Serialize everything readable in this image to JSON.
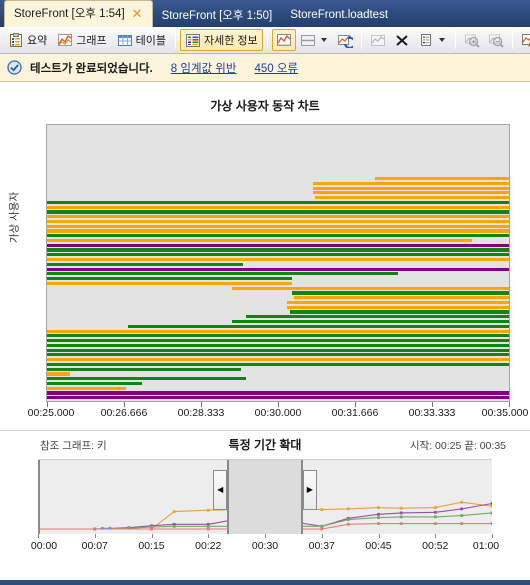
{
  "window": {
    "tabs": [
      {
        "label": "StoreFront [오후 1:54]",
        "active": true,
        "closable": true,
        "close_glyph": "✕"
      },
      {
        "label": "StoreFront [오후 1:50]",
        "active": false,
        "closable": false
      },
      {
        "label": "StoreFront.loadtest",
        "active": false,
        "closable": false
      }
    ]
  },
  "toolbar": {
    "items": [
      {
        "name": "summary",
        "label": "요약",
        "icon": "clipboard-icon",
        "checked": false,
        "disabled": false,
        "type": "text"
      },
      {
        "name": "graphs",
        "label": "그래프",
        "icon": "line-chart-icon",
        "checked": false,
        "disabled": false,
        "type": "text"
      },
      {
        "name": "tables",
        "label": "테이블",
        "icon": "table-icon",
        "checked": false,
        "disabled": false,
        "type": "text"
      },
      {
        "name": "details",
        "label": "자세한 정보",
        "icon": "details-icon",
        "checked": true,
        "disabled": false,
        "type": "text"
      },
      {
        "name": "separator-1",
        "type": "separator"
      },
      {
        "name": "show-graph",
        "label": "",
        "icon": "graph-toggle-icon",
        "checked": true,
        "disabled": false,
        "type": "icon"
      },
      {
        "name": "panel-layout",
        "label": "",
        "icon": "panel-layout-icon",
        "checked": false,
        "disabled": false,
        "type": "icon",
        "dropdown": true
      },
      {
        "name": "refresh-graph",
        "label": "",
        "icon": "refresh-graph-icon",
        "checked": false,
        "disabled": false,
        "type": "icon"
      },
      {
        "name": "separator-2",
        "type": "separator"
      },
      {
        "name": "add-graph",
        "label": "",
        "icon": "add-graph-icon",
        "checked": false,
        "disabled": true,
        "type": "icon"
      },
      {
        "name": "delete-graph",
        "label": "",
        "icon": "close-x-icon",
        "checked": false,
        "disabled": false,
        "type": "icon"
      },
      {
        "name": "legend-list",
        "label": "",
        "icon": "legend-list-icon",
        "checked": false,
        "disabled": false,
        "type": "icon",
        "dropdown": true
      },
      {
        "name": "separator-3",
        "type": "separator"
      },
      {
        "name": "zoom-in",
        "label": "",
        "icon": "zoom-in-icon",
        "checked": false,
        "disabled": true,
        "type": "icon"
      },
      {
        "name": "zoom-out",
        "label": "",
        "icon": "zoom-out-icon",
        "checked": false,
        "disabled": true,
        "type": "icon"
      },
      {
        "name": "separator-4",
        "type": "separator"
      },
      {
        "name": "edit-graph",
        "label": "",
        "icon": "edit-graph-icon",
        "checked": false,
        "disabled": false,
        "type": "icon"
      }
    ]
  },
  "status": {
    "icon": "check-circle-icon",
    "message": "테스트가 완료되었습니다.",
    "links": [
      {
        "name": "threshold-violations-link",
        "label": "8 임계값 위반"
      },
      {
        "name": "errors-link",
        "label": "450 오류"
      }
    ]
  },
  "chart_data": {
    "type": "bar",
    "title": "가상 사용자 동작 차트",
    "xlabel": "",
    "ylabel": "가상 사용자",
    "grid": false,
    "orientation": "horizontal",
    "xlim": [
      25.0,
      35.0
    ],
    "xtick_labels": [
      "00:25.000",
      "00:26.666",
      "00:28.333",
      "00:30.000",
      "00:31.666",
      "00:33.333",
      "00:35.000"
    ],
    "xtick_values": [
      25.0,
      26.666,
      28.333,
      30.0,
      31.666,
      33.333,
      35.0
    ],
    "colors": {
      "green": "#118511",
      "orange": "#FFA500",
      "purple": "#800080"
    },
    "legend": [],
    "bars": [
      {
        "row": 0,
        "start": 32.1,
        "end": 35.0,
        "color": "#FFA500"
      },
      {
        "row": 1,
        "start": 30.75,
        "end": 35.0,
        "color": "#FFA500"
      },
      {
        "row": 2,
        "start": 30.75,
        "end": 35.0,
        "color": "#FFA500"
      },
      {
        "row": 3,
        "start": 30.75,
        "end": 35.0,
        "color": "#FFA500"
      },
      {
        "row": 4,
        "start": 30.8,
        "end": 35.0,
        "color": "#FFA500"
      },
      {
        "row": 5,
        "start": 25.0,
        "end": 35.0,
        "color": "#118511"
      },
      {
        "row": 6,
        "start": 25.0,
        "end": 35.0,
        "color": "#FFA500"
      },
      {
        "row": 7,
        "start": 25.0,
        "end": 35.0,
        "color": "#118511"
      },
      {
        "row": 8,
        "start": 25.0,
        "end": 35.0,
        "color": "#FFA500"
      },
      {
        "row": 9,
        "start": 25.0,
        "end": 35.0,
        "color": "#FFA500"
      },
      {
        "row": 10,
        "start": 25.0,
        "end": 35.0,
        "color": "#FFA500"
      },
      {
        "row": 11,
        "start": 25.0,
        "end": 35.0,
        "color": "#FFA500"
      },
      {
        "row": 12,
        "start": 25.0,
        "end": 35.0,
        "color": "#118511"
      },
      {
        "row": 13,
        "start": 25.0,
        "end": 34.2,
        "color": "#FFA500"
      },
      {
        "row": 14,
        "start": 25.0,
        "end": 35.0,
        "color": "#800080"
      },
      {
        "row": 15,
        "start": 25.0,
        "end": 35.0,
        "color": "#118511"
      },
      {
        "row": 16,
        "start": 25.0,
        "end": 35.0,
        "color": "#118511"
      },
      {
        "row": 17,
        "start": 25.0,
        "end": 35.0,
        "color": "#FFA500"
      },
      {
        "row": 18,
        "start": 25.0,
        "end": 29.25,
        "color": "#118511"
      },
      {
        "row": 19,
        "start": 25.0,
        "end": 35.0,
        "color": "#800080"
      },
      {
        "row": 20,
        "start": 25.0,
        "end": 32.6,
        "color": "#118511"
      },
      {
        "row": 21,
        "start": 25.0,
        "end": 30.3,
        "color": "#118511"
      },
      {
        "row": 22,
        "start": 25.0,
        "end": 30.3,
        "color": "#FFA500"
      },
      {
        "row": 23,
        "start": 29.0,
        "end": 35.0,
        "color": "#FFA500"
      },
      {
        "row": 24,
        "start": 30.3,
        "end": 35.0,
        "color": "#118511"
      },
      {
        "row": 25,
        "start": 30.35,
        "end": 35.0,
        "color": "#FFA500"
      },
      {
        "row": 26,
        "start": 30.2,
        "end": 35.0,
        "color": "#FFA500"
      },
      {
        "row": 27,
        "start": 30.2,
        "end": 35.0,
        "color": "#FFA500"
      },
      {
        "row": 28,
        "start": 30.25,
        "end": 35.0,
        "color": "#118511"
      },
      {
        "row": 29,
        "start": 29.3,
        "end": 35.0,
        "color": "#118511"
      },
      {
        "row": 30,
        "start": 29.0,
        "end": 35.0,
        "color": "#118511"
      },
      {
        "row": 31,
        "start": 26.75,
        "end": 35.0,
        "color": "#118511"
      },
      {
        "row": 32,
        "start": 25.0,
        "end": 35.0,
        "color": "#FFA500"
      },
      {
        "row": 33,
        "start": 25.0,
        "end": 35.0,
        "color": "#118511"
      },
      {
        "row": 34,
        "start": 25.0,
        "end": 35.0,
        "color": "#118511"
      },
      {
        "row": 35,
        "start": 25.0,
        "end": 35.0,
        "color": "#118511"
      },
      {
        "row": 36,
        "start": 25.0,
        "end": 35.0,
        "color": "#118511"
      },
      {
        "row": 37,
        "start": 25.0,
        "end": 35.0,
        "color": "#118511"
      },
      {
        "row": 38,
        "start": 25.0,
        "end": 35.0,
        "color": "#FFA500"
      },
      {
        "row": 39,
        "start": 25.0,
        "end": 35.0,
        "color": "#118511"
      },
      {
        "row": 40,
        "start": 25.0,
        "end": 29.2,
        "color": "#118511"
      },
      {
        "row": 41,
        "start": 25.0,
        "end": 25.5,
        "color": "#FFA500"
      },
      {
        "row": 42,
        "start": 25.0,
        "end": 29.3,
        "color": "#118511"
      },
      {
        "row": 43,
        "start": 25.0,
        "end": 27.05,
        "color": "#118511"
      },
      {
        "row": 44,
        "start": 25.0,
        "end": 26.7,
        "color": "#FFA500"
      },
      {
        "row": 45,
        "start": 25.0,
        "end": 35.0,
        "color": "#800080"
      },
      {
        "row": 46,
        "start": 25.0,
        "end": 35.0,
        "color": "#800080"
      }
    ]
  },
  "navigator": {
    "reference_label": "참조 그래프: 키",
    "title": "특정 기간 확대",
    "range_label": "시작: 00:25 끝: 00:35",
    "selection": {
      "start": 25,
      "end": 35
    },
    "left_handle_glyph": "◀",
    "right_handle_glyph": "▶",
    "chart_data": {
      "type": "line",
      "xlim": [
        0,
        60
      ],
      "ylim": [
        0,
        100
      ],
      "grid": false,
      "xtick_labels": [
        "00:00",
        "00:07",
        "00:15",
        "00:22",
        "00:30",
        "00:37",
        "00:45",
        "00:52",
        "01:00"
      ],
      "xtick_values": [
        0,
        7.5,
        15,
        22.5,
        30,
        37.5,
        45,
        52.5,
        60
      ],
      "series": [
        {
          "name": "series-orange",
          "color": "#E8A33D",
          "x": [
            0,
            7.5,
            15,
            18,
            22.5,
            26,
            30,
            33,
            37.5,
            41,
            45,
            48,
            52.5,
            56,
            60
          ],
          "y": [
            0,
            0,
            0,
            26,
            28,
            29,
            32,
            30,
            29,
            30,
            32,
            31,
            32,
            40,
            34
          ]
        },
        {
          "name": "series-purple",
          "color": "#9B4FA0",
          "x": [
            0,
            7.5,
            12,
            15,
            18,
            22.5,
            26,
            30,
            33,
            37.5,
            41,
            45,
            48,
            52.5,
            56,
            60
          ],
          "y": [
            0,
            0,
            2,
            5,
            7,
            7,
            14,
            22,
            12,
            4,
            16,
            22,
            24,
            25,
            30,
            38
          ]
        },
        {
          "name": "series-green",
          "color": "#6BAE5E",
          "x": [
            0,
            7.5,
            12,
            15,
            18,
            22.5,
            26,
            30,
            33,
            37.5,
            41,
            45,
            48,
            52.5,
            56,
            60
          ],
          "y": [
            0,
            0,
            1,
            3,
            4,
            4,
            4,
            4,
            4,
            4,
            14,
            17,
            18,
            18,
            20,
            24
          ]
        },
        {
          "name": "series-red",
          "color": "#E87A7A",
          "x": [
            0,
            15,
            22.5,
            30,
            37.5,
            41,
            45,
            48,
            52.5,
            56,
            60
          ],
          "y": [
            0,
            0,
            0,
            0,
            0,
            7,
            8,
            8,
            8,
            8,
            8
          ]
        },
        {
          "name": "series-blue",
          "color": "#7A8FD8",
          "x": [
            8.5,
            9.5
          ],
          "y": [
            1,
            1
          ]
        }
      ]
    }
  }
}
